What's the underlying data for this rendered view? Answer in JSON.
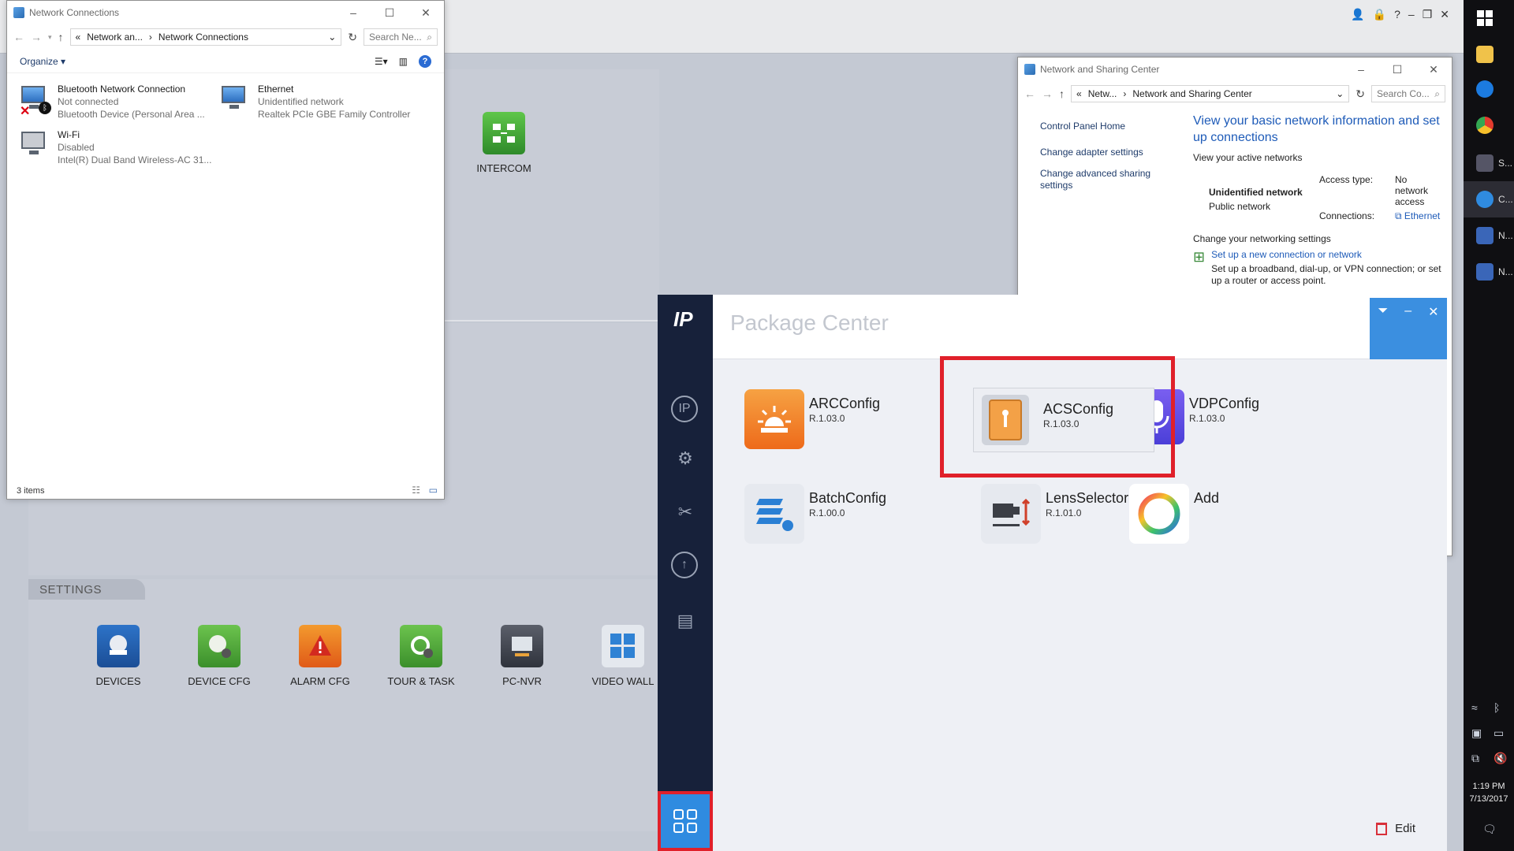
{
  "bg_app": {
    "intercom_label": "INTERCOM",
    "settings_header": "SETTINGS",
    "settings_items": [
      {
        "label": "DEVICES",
        "icon": "camera-dome-icon"
      },
      {
        "label": "DEVICE CFG",
        "icon": "camera-gear-icon"
      },
      {
        "label": "ALARM CFG",
        "icon": "alarm-gear-icon"
      },
      {
        "label": "TOUR & TASK",
        "icon": "tour-gear-icon"
      },
      {
        "label": "PC-NVR",
        "icon": "pc-nvr-icon"
      },
      {
        "label": "VIDEO WALL",
        "icon": "video-wall-icon"
      }
    ]
  },
  "netconn": {
    "title": "Network Connections",
    "address": {
      "prefix": "«",
      "part1": "Network an...",
      "sep": "›",
      "part2": "Network Connections"
    },
    "search_placeholder": "Search Ne...",
    "organize": "Organize ▾",
    "items": [
      {
        "name": "Bluetooth Network Connection",
        "status": "Not connected",
        "device": "Bluetooth Device (Personal Area ..."
      },
      {
        "name": "Ethernet",
        "status": "Unidentified network",
        "device": "Realtek PCIe GBE Family Controller"
      },
      {
        "name": "Wi-Fi",
        "status": "Disabled",
        "device": "Intel(R) Dual Band Wireless-AC 31..."
      }
    ],
    "status_bar": "3 items"
  },
  "nsc": {
    "title": "Network and Sharing Center",
    "address": {
      "prefix": "«",
      "part1": "Netw...",
      "sep": "›",
      "part2": "Network and Sharing Center"
    },
    "search_placeholder": "Search Co...",
    "left_links": [
      "Control Panel Home",
      "Change adapter settings",
      "Change advanced sharing settings"
    ],
    "heading": "View your basic network information and set up connections",
    "active_networks_label": "View your active networks",
    "network_name": "Unidentified network",
    "network_type": "Public network",
    "access_type_label": "Access type:",
    "access_type_value": "No network access",
    "connections_label": "Connections:",
    "connections_value": "Ethernet",
    "change_settings_label": "Change your networking settings",
    "setup_link": "Set up a new connection or network",
    "setup_desc": "Set up a broadband, dial-up, or VPN connection; or set up a router or access point."
  },
  "pkg": {
    "title": "Package Center",
    "items": [
      {
        "name": "ARCConfig",
        "version": "R.1.03.0"
      },
      {
        "name": "ACSConfig",
        "version": "R.1.03.0"
      },
      {
        "name": "VDPConfig",
        "version": "R.1.03.0"
      },
      {
        "name": "BatchConfig",
        "version": "R.1.00.0"
      },
      {
        "name": "LensSelector",
        "version": "R.1.01.0"
      },
      {
        "name": "Add",
        "version": ""
      }
    ],
    "edit_label": "Edit"
  },
  "taskbar": {
    "items": [
      {
        "label": "S...",
        "icon": "smartpss-icon"
      },
      {
        "label": "C...",
        "icon": "config-icon"
      },
      {
        "label": "N...",
        "icon": "network-icon"
      },
      {
        "label": "N...",
        "icon": "network-icon"
      }
    ],
    "time": "1:19 PM",
    "date": "7/13/2017"
  },
  "colors": {
    "accent": "#2f8be0",
    "highlight": "#e0202a",
    "sidebar": "#17213a"
  }
}
